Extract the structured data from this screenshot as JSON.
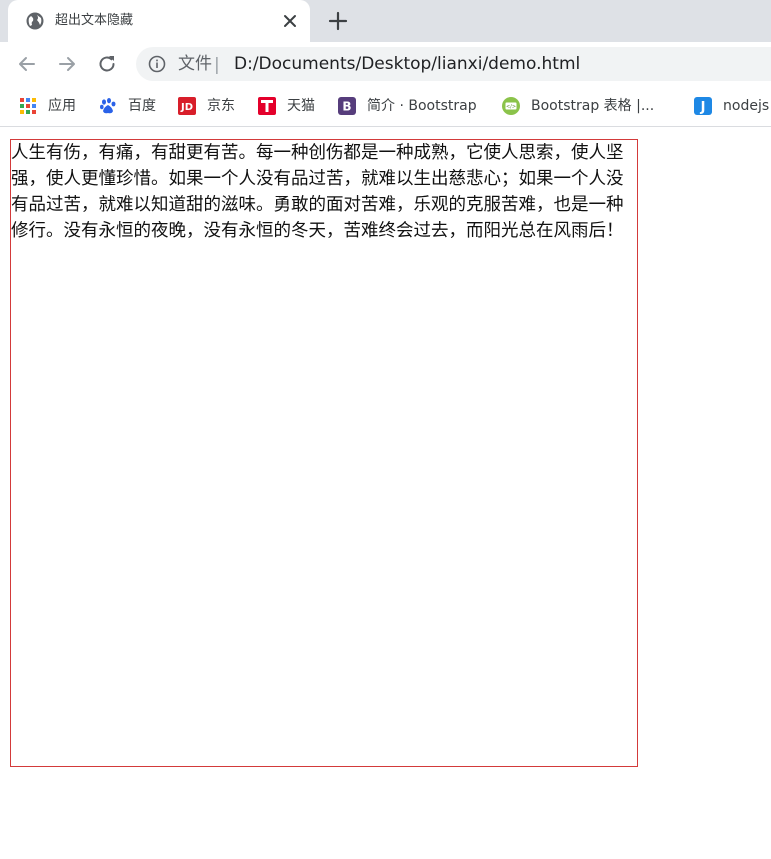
{
  "browser": {
    "tab": {
      "title": "超出文本隐藏"
    },
    "address": {
      "scheme_label": "文件",
      "separator": "|",
      "url": "D:/Documents/Desktop/lianxi/demo.html"
    },
    "bookmarks": [
      {
        "label": "应用",
        "icon": "apps-grid-icon"
      },
      {
        "label": "百度",
        "icon": "baidu-paw-icon"
      },
      {
        "label": "京东",
        "icon": "jd-logo-icon"
      },
      {
        "label": "天猫",
        "icon": "tmall-logo-icon"
      },
      {
        "label": "简介 · Bootstrap",
        "icon": "bootstrap-logo-icon"
      },
      {
        "label": "Bootstrap 表格 |...",
        "icon": "runoob-logo-icon"
      },
      {
        "label": "nodejs",
        "icon": "j-logo-icon"
      }
    ]
  },
  "page": {
    "paragraph": "人生有伤，有痛，有甜更有苦。每一种创伤都是一种成熟，它使人思索，使人坚强，使人更懂珍惜。如果一个人没有品过苦，就难以生出慈悲心；如果一个人没有品过苦，就难以知道甜的滋味。勇敢的面对苦难，乐观的克服苦难，也是一种修行。没有永恒的夜晚，没有永恒的冬天，苦难终会过去，而阳光总在风雨后！"
  },
  "colors": {
    "box_border": "#d33a3a",
    "tabstrip_bg": "#dee1e6",
    "omnibox_bg": "#f1f3f4"
  }
}
